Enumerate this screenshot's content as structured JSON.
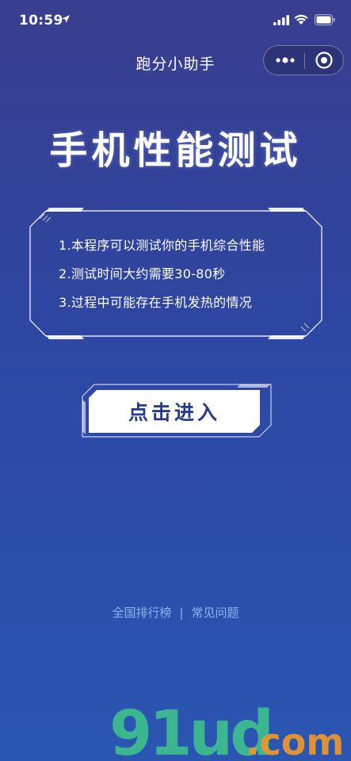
{
  "status_bar": {
    "time": "10:59"
  },
  "nav": {
    "title": "跑分小助手"
  },
  "hero": {
    "title": "手机性能测试"
  },
  "info": {
    "lines": [
      "1.本程序可以测试你的手机综合性能",
      "2.测试时间大约需要30-80秒",
      "3.过程中可能存在手机发热的情况"
    ]
  },
  "enter_button": {
    "label": "点击进入"
  },
  "footer": {
    "ranking_label": "全国排行榜",
    "separator": "|",
    "faq_label": "常见问题"
  },
  "watermark": {
    "text": "91ud.com"
  },
  "colors": {
    "background_top": "#3a3e8e",
    "background_bottom": "#2a56b2",
    "button_text": "#2a3a8a",
    "link": "#8fb4f2",
    "watermark_green": "#3dbf8f",
    "watermark_orange": "#e8962f"
  }
}
